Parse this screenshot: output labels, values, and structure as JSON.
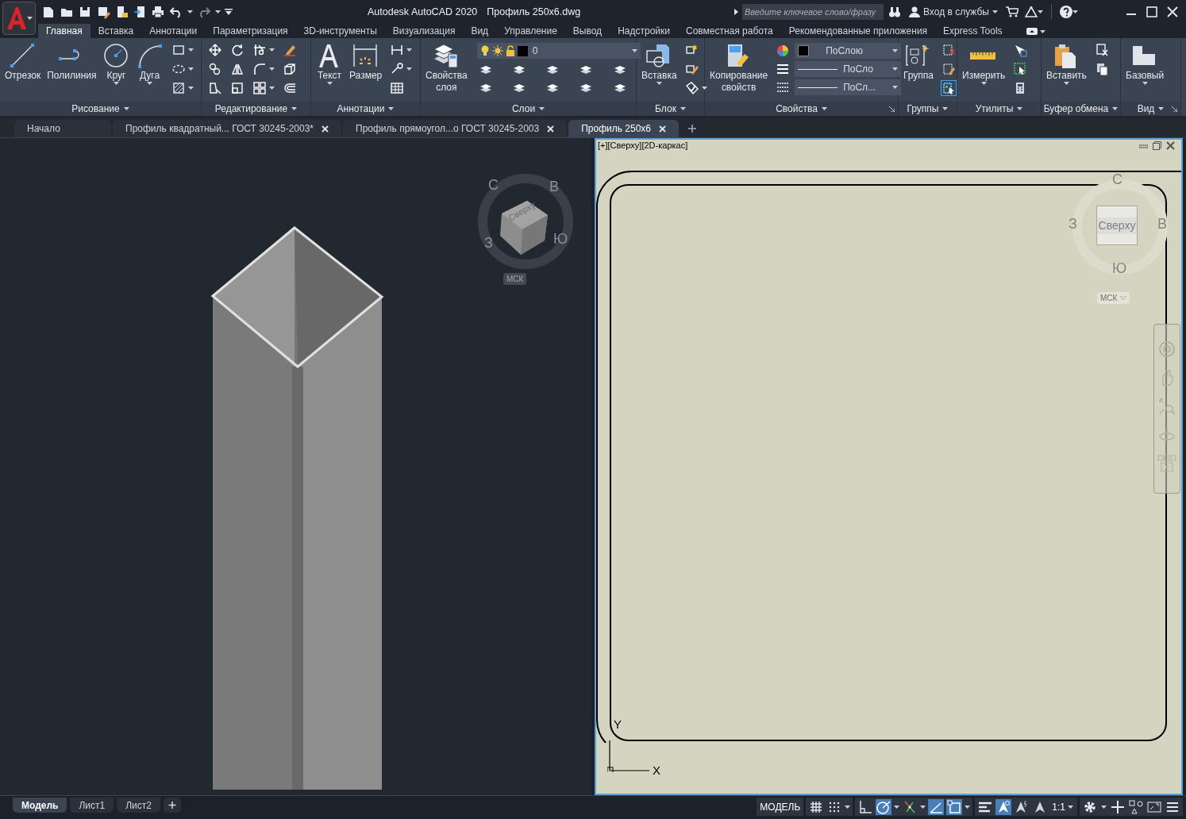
{
  "title_bar": {
    "app_name": "Autodesk AutoCAD 2020",
    "file_name": "Профиль 250x6.dwg",
    "search_placeholder": "Введите ключевое слово/фразу",
    "sign_in": "Вход в службы"
  },
  "ribbon_tabs": [
    {
      "label": "Главная",
      "selected": true
    },
    {
      "label": "Вставка",
      "selected": false
    },
    {
      "label": "Аннотации",
      "selected": false
    },
    {
      "label": "Параметризация",
      "selected": false
    },
    {
      "label": "3D-инструменты",
      "selected": false
    },
    {
      "label": "Визуализация",
      "selected": false
    },
    {
      "label": "Вид",
      "selected": false
    },
    {
      "label": "Управление",
      "selected": false
    },
    {
      "label": "Вывод",
      "selected": false
    },
    {
      "label": "Надстройки",
      "selected": false
    },
    {
      "label": "Совместная работа",
      "selected": false
    },
    {
      "label": "Рекомендованные приложения",
      "selected": false
    },
    {
      "label": "Express Tools",
      "selected": false
    }
  ],
  "ribbon_panels": [
    {
      "title": "Рисование",
      "kind": "tools",
      "launcher": false,
      "tools": [
        {
          "label": "Отрезок",
          "menu": false
        },
        {
          "label": "Полилиния",
          "menu": false
        },
        {
          "label": "Круг",
          "menu": true
        },
        {
          "label": "Дуга",
          "menu": true
        }
      ]
    },
    {
      "title": "Редактирование",
      "kind": "tools",
      "launcher": false
    },
    {
      "title": "Аннотации",
      "kind": "tools",
      "launcher": false,
      "tools": [
        {
          "label": "Текст",
          "menu": true
        },
        {
          "label": "Размер",
          "menu": false
        }
      ]
    },
    {
      "title": "Слои",
      "kind": "layers",
      "launcher": false,
      "tools": [
        {
          "label": "Свойства слоя",
          "menu": false
        }
      ],
      "layer": "0"
    },
    {
      "title": "Блок",
      "kind": "tools",
      "launcher": false,
      "tools": [
        {
          "label": "Вставка",
          "menu": true
        }
      ]
    },
    {
      "title": "Свойства",
      "kind": "properties",
      "launcher": true,
      "tools": [
        {
          "label": "Копирование свойств",
          "menu": false
        }
      ],
      "dropdowns": [
        "ПоСлою",
        "ПоСло",
        "ПоСл..."
      ]
    },
    {
      "title": "Группы",
      "kind": "tools",
      "launcher": false,
      "tools": [
        {
          "label": "Группа",
          "menu": false
        }
      ],
      "toggle_on": true
    },
    {
      "title": "Утилиты",
      "kind": "tools",
      "launcher": false,
      "tools": [
        {
          "label": "Измерить",
          "menu": true
        }
      ]
    },
    {
      "title": "Буфер обмена",
      "kind": "tools",
      "launcher": false,
      "tools": [
        {
          "label": "Вставить",
          "menu": true
        }
      ]
    },
    {
      "title": "Вид",
      "kind": "tools",
      "launcher": true,
      "tools": [
        {
          "label": "Базовый",
          "menu": true
        }
      ]
    }
  ],
  "document_tabs": [
    {
      "label": "Начало",
      "selected": false,
      "closable": false
    },
    {
      "label": "Профиль квадратный... ГОСТ 30245-2003*",
      "selected": false,
      "closable": true
    },
    {
      "label": "Профиль прямоугол...о ГОСТ 30245-2003",
      "selected": false,
      "closable": true
    },
    {
      "label": "Профиль 250x6",
      "selected": true,
      "closable": true
    }
  ],
  "viewports": [
    {
      "kind": "isometric",
      "active": false,
      "viewcube": {
        "face": "Сверху",
        "north": "С",
        "east": "В",
        "west": "З",
        "south": "Ю",
        "ucs": "МСК"
      }
    },
    {
      "kind": "plan",
      "active": true,
      "label": "[+][Сверху][2D-каркас]",
      "viewcube": {
        "face": "Сверху",
        "north": "С",
        "east": "В",
        "west": "З",
        "south": "Ю",
        "ucs": "МСК"
      },
      "ucs_icon": {
        "x": "X",
        "y": "Y"
      }
    }
  ],
  "layout_tabs": [
    {
      "label": "Модель",
      "selected": true
    },
    {
      "label": "Лист1",
      "selected": false
    },
    {
      "label": "Лист2",
      "selected": false
    }
  ],
  "status_bar": {
    "space": "МОДЕЛЬ",
    "toggles": [
      {
        "on": false
      },
      {
        "on": false
      },
      {
        "on": false
      },
      {
        "on": true
      },
      {
        "on": false
      },
      {
        "on": true
      },
      {
        "on": true
      },
      {
        "on": false
      },
      {
        "on": true
      },
      {
        "on": false
      }
    ],
    "scale": "1:1"
  }
}
